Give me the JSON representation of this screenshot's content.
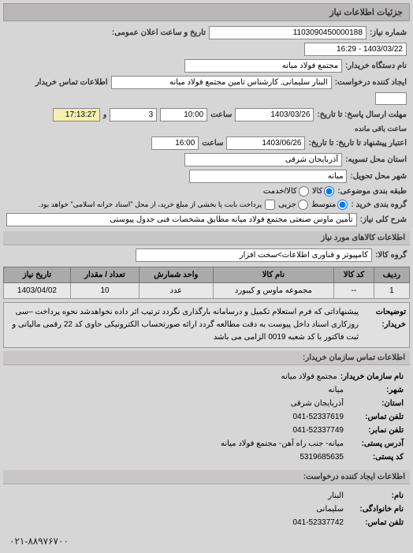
{
  "header": {
    "title": "جزئیات اطلاعات نیاز"
  },
  "form": {
    "req_no_label": "شماره نیاز:",
    "req_no": "1103090450000188",
    "pub_datetime_label": "تاریخ و ساعت اعلان عمومی:",
    "pub_datetime": "1403/03/22 - 16:29",
    "buyer_org_label": "نام دستگاه خریدار:",
    "buyer_org": "مجتمع فولاد میانه",
    "creator_label": "ایجاد کننده درخواست:",
    "creator": "البنار سلیمانی, کارشناس تامین مجتمع فولاد میانه",
    "buyer_contact_label": "اطلاعات تماس خریدار",
    "buyer_contact": "",
    "deadline_label": "مهلت ارسال پاسخ: تا تاریخ:",
    "deadline_date": "1403/03/26",
    "deadline_hour_label": "ساعت",
    "deadline_hour": "10:00",
    "remain_days": "3",
    "remain_time": "17:13:27",
    "remain_suffix": "ساعت باقی مانده",
    "validity_label": "اعتبار پیشنهاد تا تاریخ: تا تاریخ:",
    "validity_date": "1403/06/26",
    "validity_hour_label": "ساعت",
    "validity_hour": "16:00",
    "province_label": "استان محل تسویه:",
    "province": "آذربایجان شرقی",
    "city_label": "شهر محل تحویل:",
    "city": "میانه",
    "subject_group_label": "طبقه بندی موضوعی:",
    "radio_kala": "کالا",
    "radio_khedmat": "کالا/خدمت",
    "group_label": "گروه بندی خرید :",
    "radio_mid": "متوسط",
    "radio_small": "جزیی",
    "payment_note": "پرداخت بابت یا بخشی از مبلغ خرید، از محل \"اسناد خزانه اسلامی\" خواهد بود.",
    "general_title_label": "شرح کلی نیاز:",
    "general_title": "تأمین ماوس صنعتی مجتمع فولاد میانه مطابق مشخصات فنی جدول پیوستی"
  },
  "items_header": "اطلاعات کالاهای مورد نیاز",
  "items_group_label": "گروه کالا:",
  "items_group": "کامپیوتر و فناوری اطلاعات>سخت افزار",
  "table": {
    "cols": [
      "ردیف",
      "کد کالا",
      "نام کالا",
      "واحد شمارش",
      "تعداد / مقدار",
      "تاریخ نیاز"
    ],
    "rows": [
      {
        "idx": "1",
        "code": "--",
        "name": "مجموعه ماوس و کیبورد",
        "unit": "عدد",
        "qty": "10",
        "date": "1403/04/02"
      }
    ]
  },
  "buyer_desc_label": "توضیحات خریدار:",
  "buyer_desc": "پیشنهاداتی که فرم استعلام تکمیل و درسامانه بارگذاری نگردد ترتیب اثر داده نخواهدشد نحوه پرداخت –سی روزکاری اسناد داخل پیوست به دقت مطالعه گردد ارائه صورتحساب الکترونیکی حاوی کد 22 رقمی مالیاتی و ثبت فاکتور با کد شعبه 0019 الزامی می باشد",
  "contact_buyer_title": "اطلاعات تماس سازمان خریدار:",
  "contact_creator_title": "اطلاعات ایجاد کننده درخواست:",
  "contacts_buyer": {
    "org_k": "نام سازمان خریدار:",
    "org_v": "مجتمع فولاد میانه",
    "city_k": "شهر:",
    "city_v": "میانه",
    "province_k": "استان:",
    "province_v": "آذربایجان شرقی",
    "tel_k": "تلفن تماس:",
    "tel_v": "041-52337619",
    "fax_k": "تلفن نمابر:",
    "fax_v": "041-52337749",
    "addr_k": "آدرس پستی:",
    "addr_v": "میانه- جنب راه آهن- مجتمع فولاد میانه",
    "post_k": "کد پستی:",
    "post_v": "5319685635"
  },
  "contacts_creator": {
    "name_k": "نام:",
    "name_v": "البنار",
    "family_k": "نام خانوادگی:",
    "family_v": "سلیمانی",
    "tel_k": "تلفن تماس:",
    "tel_v": "041-52337742"
  },
  "footer_tel": "۰۲۱-۸۸۹۷۶۷۰۰"
}
